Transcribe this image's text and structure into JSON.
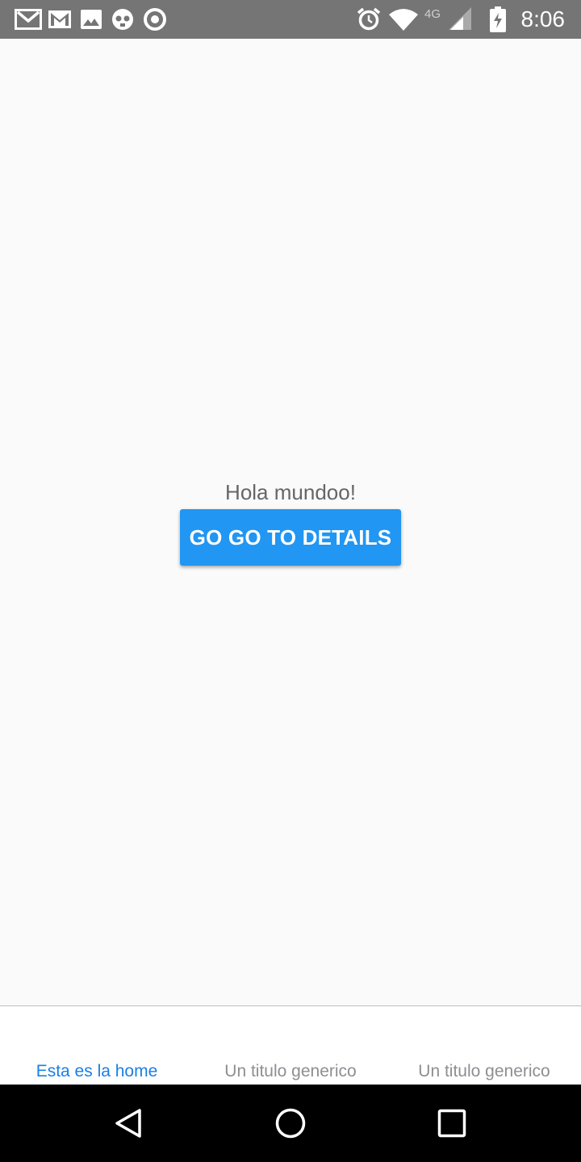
{
  "status_bar": {
    "time": "8:06",
    "network": "4G",
    "left_icons": [
      "gmail-icon",
      "gmail-icon",
      "image-icon",
      "pirate-icon",
      "record-icon"
    ],
    "right_icons": [
      "alarm-icon",
      "wifi-icon",
      "signal-icon",
      "battery-charging-icon"
    ]
  },
  "main": {
    "greeting": "Hola mundoo!",
    "button_label": "GO GO TO DETAILS"
  },
  "tabs": [
    {
      "label": "Esta es la home",
      "active": true
    },
    {
      "label": "Un titulo generico",
      "active": false
    },
    {
      "label": "Un titulo generico",
      "active": false
    }
  ],
  "nav_bar": {
    "buttons": [
      "back-icon",
      "home-icon",
      "recents-icon"
    ]
  },
  "colors": {
    "accent": "#2196f3",
    "active_tab": "#1a7fe6",
    "inactive_tab": "#8e8e93",
    "status_bar": "#757575"
  }
}
